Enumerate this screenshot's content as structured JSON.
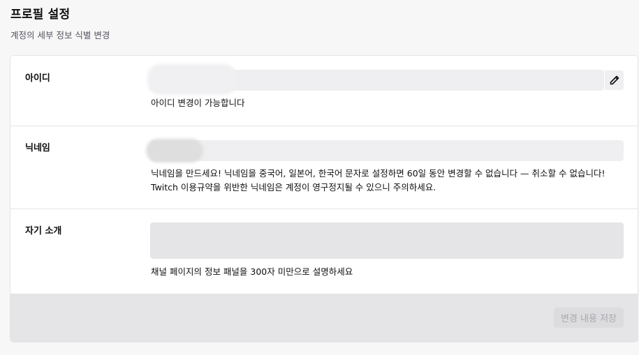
{
  "header": {
    "title": "프로필 설정",
    "subtitle": "계정의 세부 정보 식별 변경"
  },
  "fields": {
    "username": {
      "label": "아이디",
      "value": "",
      "help": "아이디 변경이 가능합니다",
      "edit_icon": "pencil-icon"
    },
    "display_name": {
      "label": "닉네임",
      "value": "",
      "help": "닉네임을 만드세요! 닉네임을 중국어, 일본어, 한국어 문자로 설정하면 60일 동안 변경할 수 없습니다 — 취소할 수 없습니다! Twitch 이용규약을 위반한 닉네임은 계정이 영구정지될 수 있으니 주의하세요."
    },
    "bio": {
      "label": "자기 소개",
      "value": "",
      "help": "채널 페이지의 정보 패널을 300자 미만으로 설명하세요"
    }
  },
  "footer": {
    "save_label": "변경 내용 저장"
  },
  "colors": {
    "background": "#f7f7f8",
    "card": "#ffffff",
    "input": "#efeff1",
    "footer": "#e5e5e8",
    "button_disabled_text": "#a8a8ae"
  }
}
